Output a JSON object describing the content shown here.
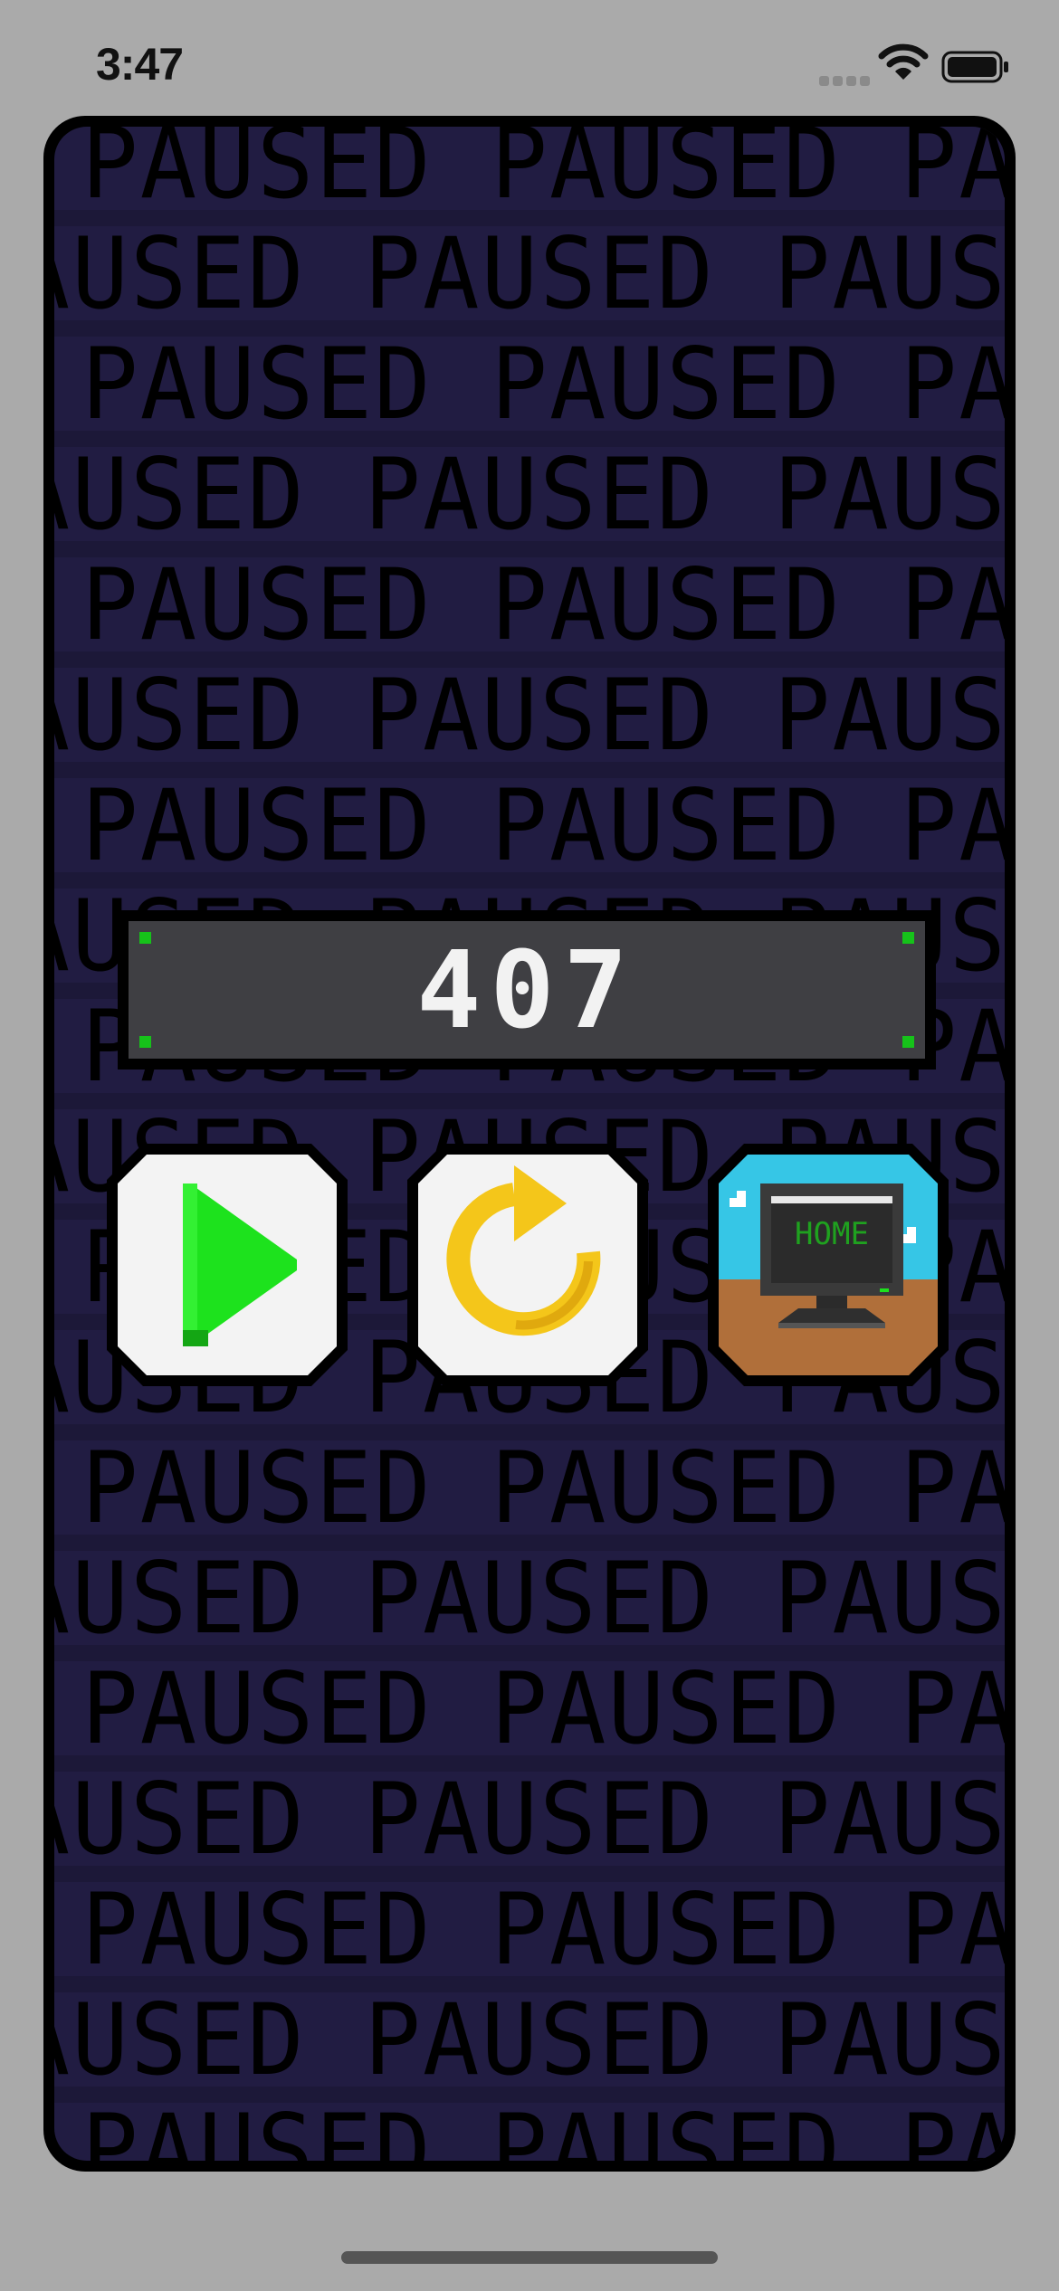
{
  "status_bar": {
    "time": "3:47",
    "icons": [
      "cellular-signal-icon",
      "wifi-icon",
      "battery-icon"
    ]
  },
  "background_text": "PAUSED",
  "score": "407",
  "buttons": [
    {
      "name": "resume-button",
      "icon": "play-icon",
      "color": "#1de21d"
    },
    {
      "name": "restart-button",
      "icon": "restart-arrow-icon",
      "color": "#f4c61a"
    },
    {
      "name": "home-button",
      "icon": "home-computer-icon",
      "label": "HOME",
      "color": "#1fa11f"
    }
  ],
  "colors": {
    "background": "#211c42",
    "score_panel": "#3f3f43",
    "corner_lights": "#16c21a",
    "page": "#aaaaaa"
  }
}
